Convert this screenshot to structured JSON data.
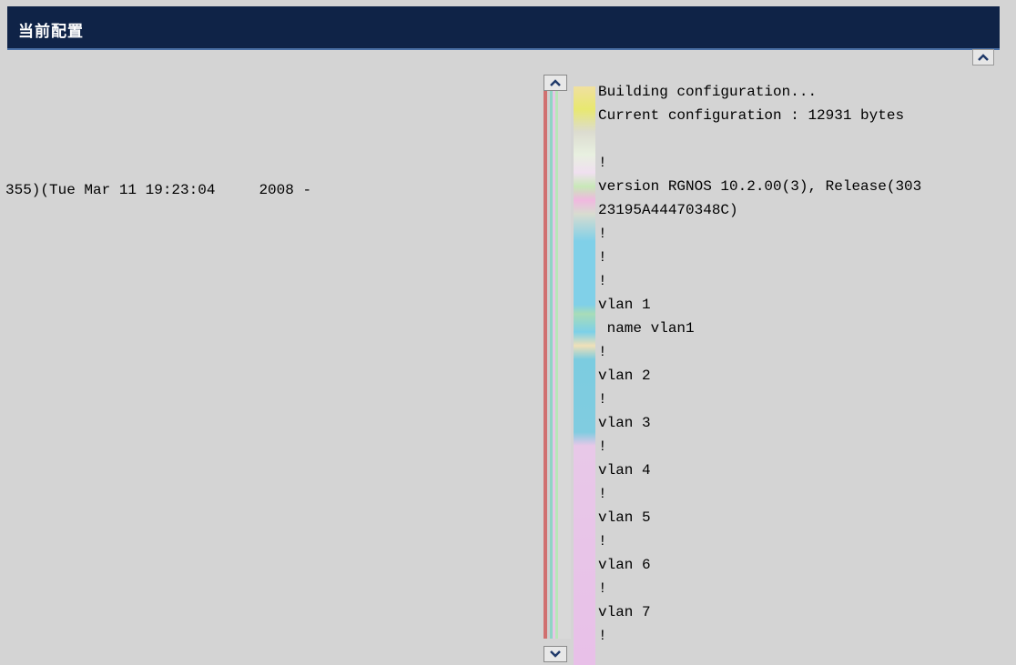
{
  "window": {
    "title": "当前配置"
  },
  "left_panel": {
    "line": "355)(Tue Mar 11 19:23:04     2008 -"
  },
  "config_lines": [
    "Building configuration...",
    "Current configuration : 12931 bytes",
    "",
    "!",
    "version RGNOS 10.2.00(3), Release(303",
    "23195A44470348C)",
    "!",
    "!",
    "!",
    "vlan 1",
    " name vlan1",
    "!",
    "vlan 2",
    "!",
    "vlan 3",
    "!",
    "vlan 4",
    "!",
    "vlan 5",
    "!",
    "vlan 6",
    "!",
    "vlan 7",
    "!"
  ],
  "colors": {
    "title_bg": "#0f2347",
    "panel_bg": "#d4d4d4"
  },
  "icons": {
    "scroll_up": "chevron-up-icon",
    "scroll_down": "chevron-down-icon"
  }
}
